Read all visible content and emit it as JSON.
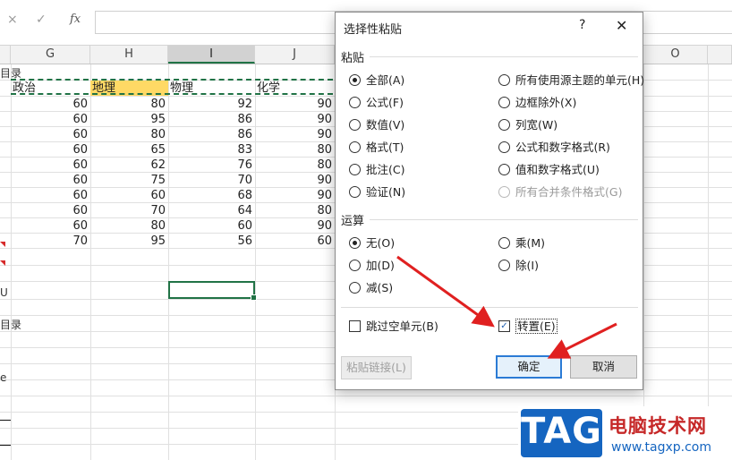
{
  "formula_bar": {
    "cancel_icon": "×",
    "enter_icon": "✓",
    "fx_label": "fx",
    "value": ""
  },
  "columns": [
    "G",
    "H",
    "I",
    "J",
    "O"
  ],
  "sheet": {
    "left_edge_fragments": [
      "目录",
      "U",
      "目录",
      "e"
    ],
    "header_row": [
      "政治",
      "地理",
      "物理",
      "化学"
    ],
    "rows": [
      [
        "60",
        "80",
        "92",
        "90"
      ],
      [
        "60",
        "95",
        "86",
        "90"
      ],
      [
        "60",
        "80",
        "86",
        "90"
      ],
      [
        "60",
        "65",
        "83",
        "80"
      ],
      [
        "60",
        "62",
        "76",
        "80"
      ],
      [
        "60",
        "75",
        "70",
        "90"
      ],
      [
        "60",
        "60",
        "68",
        "90"
      ],
      [
        "60",
        "70",
        "64",
        "80"
      ],
      [
        "60",
        "80",
        "60",
        "90"
      ],
      [
        "70",
        "95",
        "56",
        "60"
      ]
    ]
  },
  "dialog": {
    "title": "选择性粘贴",
    "help": "?",
    "close": "✕",
    "paste_group": "粘贴",
    "paste_left": [
      "全部(A)",
      "公式(F)",
      "数值(V)",
      "格式(T)",
      "批注(C)",
      "验证(N)"
    ],
    "paste_right": [
      "所有使用源主题的单元(H)",
      "边框除外(X)",
      "列宽(W)",
      "公式和数字格式(R)",
      "值和数字格式(U)",
      "所有合并条件格式(G)"
    ],
    "paste_selected": "全部(A)",
    "operation_group": "运算",
    "op_left": [
      "无(O)",
      "加(D)",
      "减(S)"
    ],
    "op_right": [
      "乘(M)",
      "除(I)"
    ],
    "op_selected": "无(O)",
    "skip_blanks_label": "跳过空单元(B)",
    "skip_blanks_checked": false,
    "transpose_label": "转置(E)",
    "transpose_checked": true,
    "paste_link_button": "粘贴链接(L)",
    "ok_button": "确定",
    "cancel_button": "取消"
  },
  "watermark": {
    "logo": "TAG",
    "name": "电脑技术网",
    "url": "www.tagxp.com"
  },
  "colors": {
    "excel_green": "#217346",
    "highlight": "#ffd965",
    "arrow_red": "#e02020",
    "ok_border": "#2b7bd5"
  }
}
